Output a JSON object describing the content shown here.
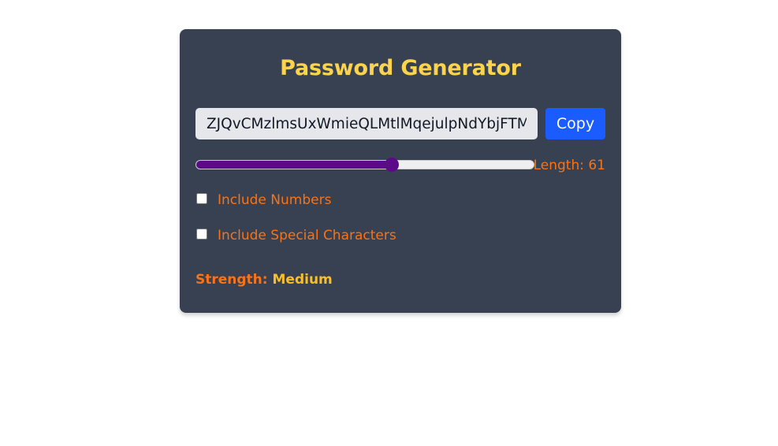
{
  "title": "Password Generator",
  "password": {
    "value": "ZJQvCMzlmsUxWmieQLMtlMqejulpNdYbjFTMo",
    "copy_label": "Copy"
  },
  "length": {
    "label": "Length: 61",
    "value": 61,
    "slider_fraction": 0.58
  },
  "options": [
    {
      "label": "Include Numbers",
      "checked": false
    },
    {
      "label": "Include Special Characters",
      "checked": false
    }
  ],
  "strength": {
    "label": "Strength:",
    "value": "Medium"
  },
  "colors": {
    "card_bg": "#374151",
    "title": "#fcd34d",
    "accent_orange": "#f97316",
    "strength_value": "#fbbf24",
    "copy_button": "#1a5cff",
    "slider": "#5b0a8a"
  }
}
